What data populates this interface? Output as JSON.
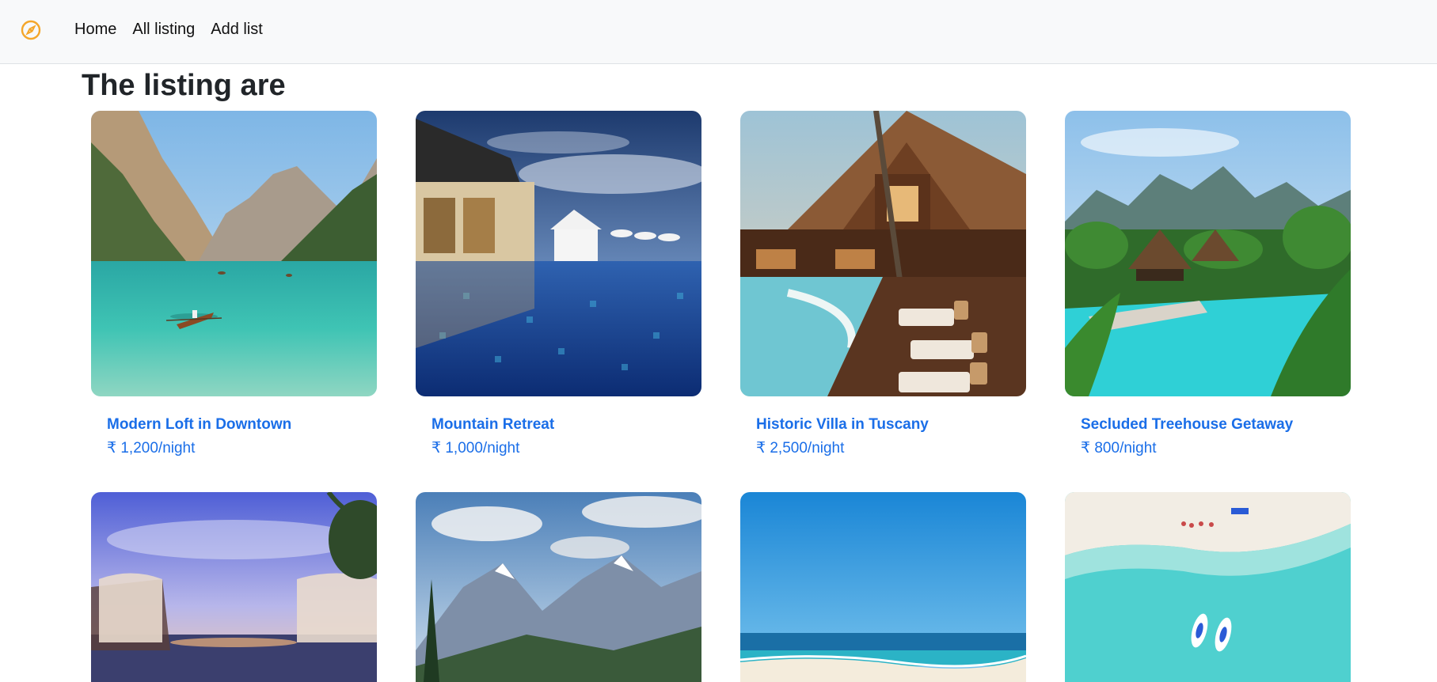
{
  "nav": {
    "brand_icon": "compass-icon",
    "brand_color": "#f4a62a",
    "links": [
      "Home",
      "All listing",
      "Add list"
    ]
  },
  "page": {
    "title": "The listing are"
  },
  "listings": [
    {
      "title": "Modern Loft in Downtown",
      "price": "₹ 1,200/night",
      "image": "mountain-lake-boat"
    },
    {
      "title": "Mountain Retreat",
      "price": "₹ 1,000/night",
      "image": "resort-pool-reflection"
    },
    {
      "title": "Historic Villa in Tuscany",
      "price": "₹ 2,500/night",
      "image": "thatched-villa-pool"
    },
    {
      "title": "Secluded Treehouse Getaway",
      "price": "₹ 800/night",
      "image": "tropical-pool-palms"
    },
    {
      "image": "sunset-cabanas"
    },
    {
      "image": "snowy-mountains-valley"
    },
    {
      "image": "blue-sea-beach"
    },
    {
      "image": "aerial-turquoise-beach"
    }
  ],
  "colors": {
    "link": "#1a6ee8",
    "navbar_bg": "#f8f9fa"
  }
}
